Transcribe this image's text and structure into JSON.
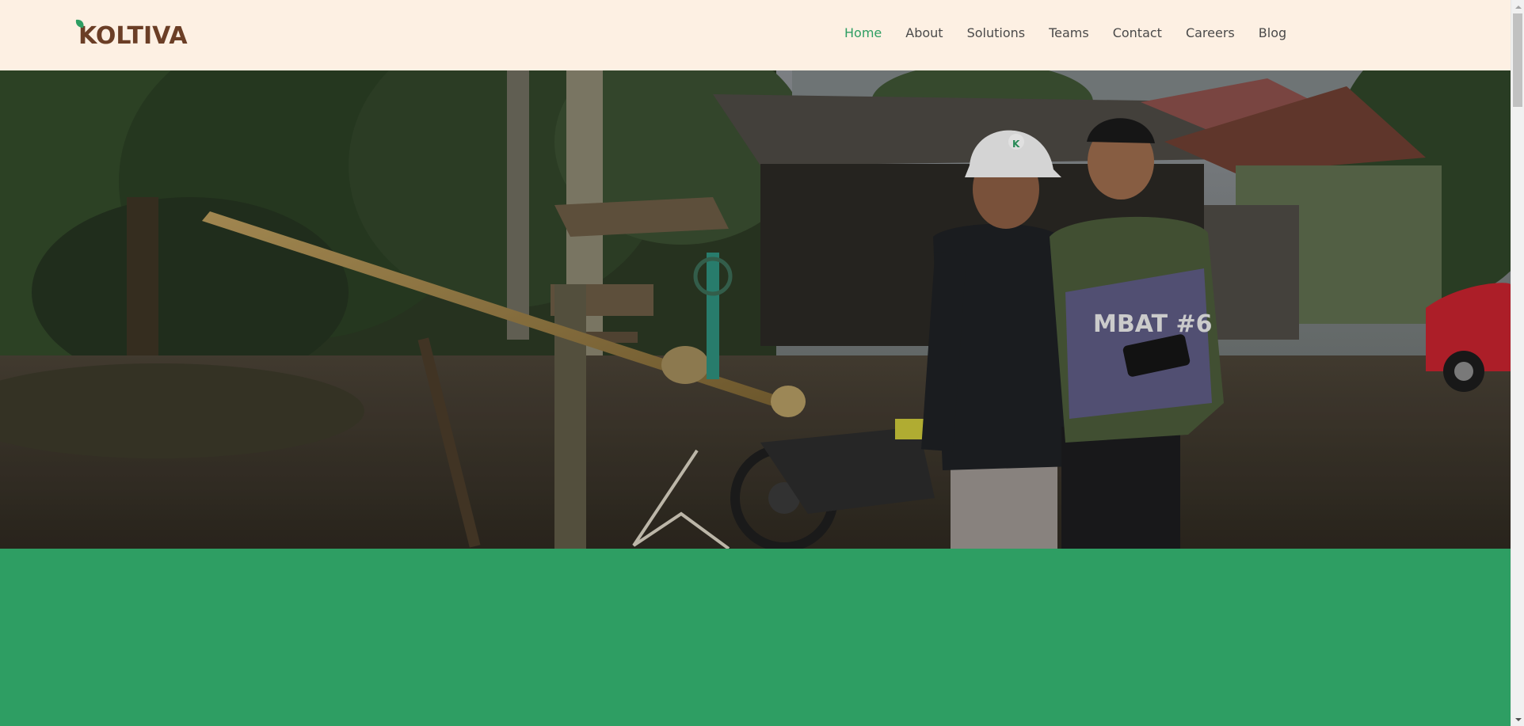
{
  "brand": {
    "name": "KOLTIVA",
    "logo_color": "#6b3e26",
    "leaf_color": "#2e9e63"
  },
  "nav": {
    "items": [
      {
        "label": "Home",
        "active": true
      },
      {
        "label": "About",
        "active": false
      },
      {
        "label": "Solutions",
        "active": false
      },
      {
        "label": "Teams",
        "active": false
      },
      {
        "label": "Contact",
        "active": false
      },
      {
        "label": "Careers",
        "active": false
      },
      {
        "label": "Blog",
        "active": false
      }
    ],
    "active_color": "#2e9e63"
  },
  "hero": {
    "image": "photo-two-farmers-with-scale",
    "helmet_letter": "K",
    "jersey_text": "MBAT #6"
  },
  "colors": {
    "header_bg": "#fdf0e3",
    "accent_green": "#2e9e63"
  },
  "scrollbar": {
    "up_icon": "scroll-up-arrow-icon",
    "down_icon": "scroll-down-arrow-icon"
  }
}
